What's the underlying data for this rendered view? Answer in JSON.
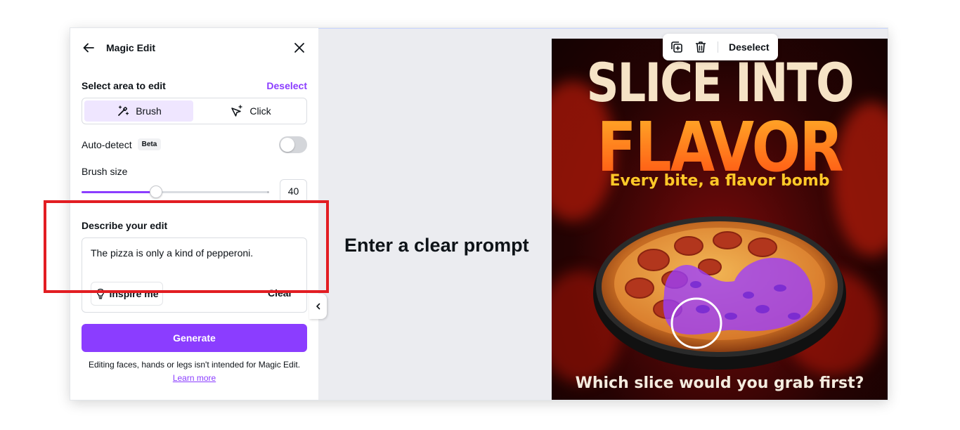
{
  "panel": {
    "title": "Magic Edit",
    "select_area_title": "Select area to edit",
    "deselect_label": "Deselect",
    "modes": [
      {
        "label": "Brush",
        "active": true,
        "icon": "magic-brush-icon"
      },
      {
        "label": "Click",
        "active": false,
        "icon": "sparkle-cursor-icon"
      }
    ],
    "auto_detect": {
      "label": "Auto-detect",
      "badge": "Beta",
      "enabled": false
    },
    "brush_size": {
      "label": "Brush size",
      "value": "40",
      "slider_fraction": 0.4
    },
    "describe": {
      "title": "Describe your edit",
      "prompt_value": "The pizza is only a kind of pepperoni.",
      "inspire_label": "Inspire me",
      "clear_label": "Clear"
    },
    "generate_label": "Generate",
    "disclaimer": "Editing faces, hands or legs isn't intended for Magic Edit.",
    "learn_more_label": "Learn more"
  },
  "toolbar": {
    "icons": [
      "duplicate-icon",
      "trash-icon"
    ],
    "deselect_label": "Deselect"
  },
  "poster": {
    "headline_line1": "SLICE INTO",
    "headline_line2": "FLAVOR",
    "subheadline": "Every bite, a flavor bomb",
    "bottom_text": "Which slice would you grab first?"
  },
  "annotation": {
    "text": "Enter a clear prompt",
    "highlight_color": "#e21d22"
  },
  "colors": {
    "accent": "#8b3dff",
    "accent_light": "#efe6ff",
    "mask_overlay": "#9b3dff"
  }
}
